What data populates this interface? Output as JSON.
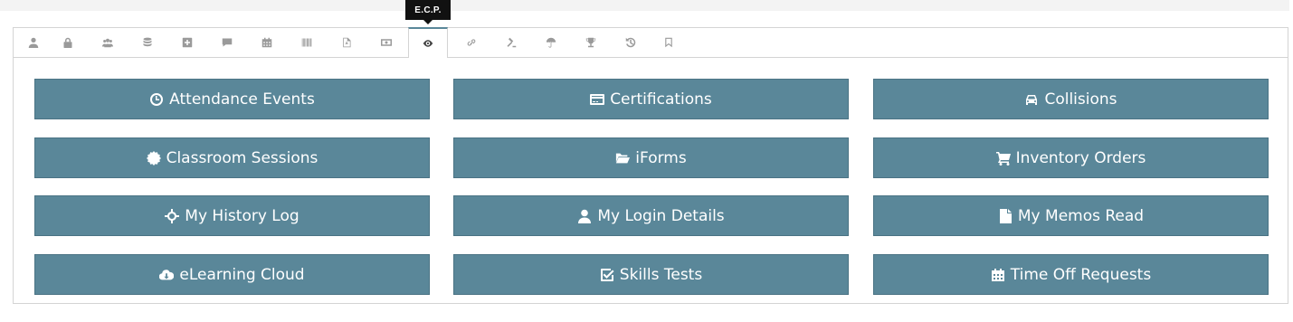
{
  "tooltip": {
    "label": "E.C.P."
  },
  "tabs": [
    {
      "icon": "user-icon"
    },
    {
      "icon": "lock-icon"
    },
    {
      "icon": "users-icon"
    },
    {
      "icon": "database-icon"
    },
    {
      "icon": "plus-square-icon"
    },
    {
      "icon": "comment-icon"
    },
    {
      "icon": "calendar-icon"
    },
    {
      "icon": "barcode-icon"
    },
    {
      "icon": "pdf-file-icon"
    },
    {
      "icon": "money-icon"
    },
    {
      "icon": "eye-icon",
      "active": true
    },
    {
      "icon": "link-icon"
    },
    {
      "icon": "gavel-icon"
    },
    {
      "icon": "umbrella-icon"
    },
    {
      "icon": "trophy-icon"
    },
    {
      "icon": "history-icon"
    },
    {
      "icon": "bookmark-icon"
    }
  ],
  "buttons": {
    "attendance_events": "Attendance Events",
    "certifications": "Certifications",
    "collisions": "Collisions",
    "classroom_sessions": "Classroom Sessions",
    "iforms": "iForms",
    "inventory_orders": "Inventory Orders",
    "my_history_log": "My History Log",
    "my_login_details": "My Login Details",
    "my_memos_read": "My Memos Read",
    "elearning_cloud": "eLearning Cloud",
    "skills_tests": "Skills Tests",
    "time_off_requests": "Time Off Requests"
  },
  "colors": {
    "button_bg": "#5a8799",
    "active_tab_accent": "#5a8799",
    "tab_icon": "#9a9a9a"
  }
}
